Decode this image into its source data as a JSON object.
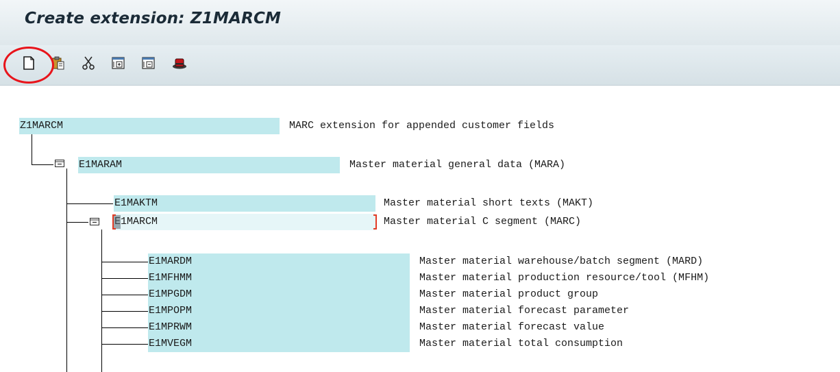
{
  "window": {
    "title": "Create extension: Z1MARCM"
  },
  "toolbar": {
    "buttons": [
      {
        "name": "create-icon"
      },
      {
        "name": "paste-icon"
      },
      {
        "name": "cut-icon"
      },
      {
        "name": "expand-subtree-icon"
      },
      {
        "name": "collapse-subtree-icon"
      },
      {
        "name": "hat-icon"
      }
    ]
  },
  "tree": {
    "root": {
      "name": "Z1MARCM",
      "description": "MARC extension for appended customer fields"
    },
    "level1": {
      "name": "E1MARAM",
      "description": "Master material general data (MARA)"
    },
    "level2": [
      {
        "name": "E1MAKTM",
        "description": "Master material short texts (MAKT)"
      },
      {
        "name": "E1MARCM",
        "description": "Master material C segment (MARC)"
      }
    ],
    "level3": [
      {
        "name": "E1MARDM",
        "description": "Master material warehouse/batch segment (MARD)"
      },
      {
        "name": "E1MFHMM",
        "description": "Master material production resource/tool (MFHM)"
      },
      {
        "name": "E1MPGDM",
        "description": "Master material product group"
      },
      {
        "name": "E1MPOPM",
        "description": "Master material forecast parameter"
      },
      {
        "name": "E1MPRWM",
        "description": "Master material forecast value"
      },
      {
        "name": "E1MVEGM",
        "description": "Master material total consumption"
      }
    ]
  },
  "colors": {
    "field_bg": "#bfe9ed",
    "highlight": "#e8141b",
    "title_text": "#1b2b37"
  }
}
